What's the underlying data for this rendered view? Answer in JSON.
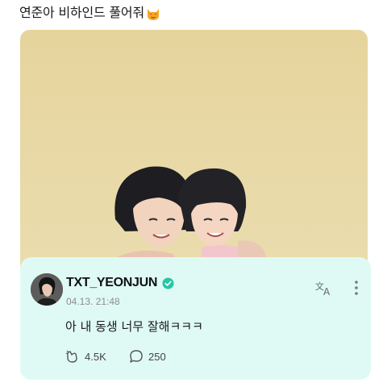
{
  "post": {
    "title": "연준아 비하인드 풀어줘",
    "emoji_icon": "heart-eyes-cat-emoji"
  },
  "photo": {
    "alt_icon": "photo-two-people"
  },
  "comment": {
    "username": "TXT_YEONJUN",
    "verified_icon": "verified-badge-icon",
    "timestamp": "04.13. 21:48",
    "text": "아 내 동생 너무 잘해ㅋㅋㅋ",
    "like_count": "4.5K",
    "reply_count": "250",
    "colors": {
      "card_bg": "#dffaf4",
      "verified": "#26c6a6"
    }
  }
}
